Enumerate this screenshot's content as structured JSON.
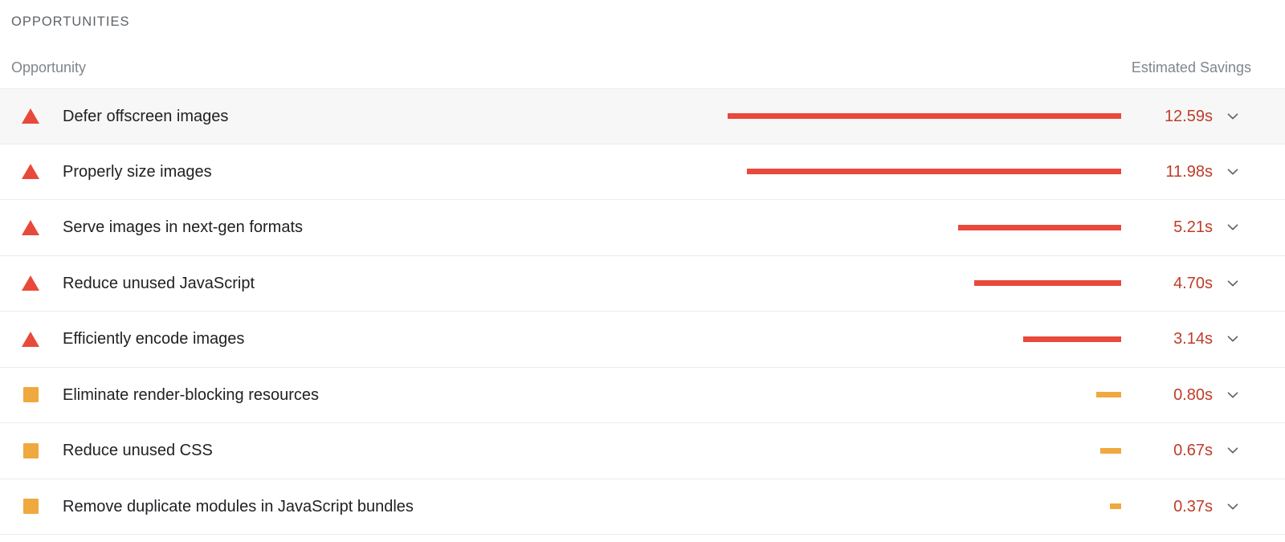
{
  "section": {
    "title": "OPPORTUNITIES"
  },
  "columns": {
    "opportunity": "Opportunity",
    "estimated_savings": "Estimated Savings"
  },
  "colors": {
    "severity_high": "#e8493a",
    "severity_medium": "#efa93f",
    "savings_text": "#bf3c28",
    "row_hover_bg": "#f7f7f7",
    "row_border": "#ebebeb",
    "header_text": "#80868b",
    "title_text": "#5f6368"
  },
  "icons": {
    "expand": "chevron-down-icon",
    "severity_high": "warning-triangle-icon",
    "severity_medium": "warning-square-icon"
  },
  "chart_data": {
    "type": "bar",
    "title": "OPPORTUNITIES",
    "xlabel": "Estimated Savings (seconds)",
    "ylabel": "Opportunity",
    "orientation": "horizontal",
    "categories": [
      "Defer offscreen images",
      "Properly size images",
      "Serve images in next-gen formats",
      "Reduce unused JavaScript",
      "Efficiently encode images",
      "Eliminate render-blocking resources",
      "Reduce unused CSS",
      "Remove duplicate modules in JavaScript bundles"
    ],
    "values": [
      12.59,
      11.98,
      5.21,
      4.7,
      3.14,
      0.8,
      0.67,
      0.37
    ],
    "units": "s",
    "xlim": [
      0,
      12.59
    ],
    "grid": false,
    "legend": false
  },
  "rows": [
    {
      "severity": "high",
      "title": "Defer offscreen images",
      "savings": "12.59s",
      "value": 12.59,
      "hovered": true
    },
    {
      "severity": "high",
      "title": "Properly size images",
      "savings": "11.98s",
      "value": 11.98,
      "hovered": false
    },
    {
      "severity": "high",
      "title": "Serve images in next-gen formats",
      "savings": "5.21s",
      "value": 5.21,
      "hovered": false
    },
    {
      "severity": "high",
      "title": "Reduce unused JavaScript",
      "savings": "4.70s",
      "value": 4.7,
      "hovered": false
    },
    {
      "severity": "high",
      "title": "Efficiently encode images",
      "savings": "3.14s",
      "value": 3.14,
      "hovered": false
    },
    {
      "severity": "medium",
      "title": "Eliminate render-blocking resources",
      "savings": "0.80s",
      "value": 0.8,
      "hovered": false
    },
    {
      "severity": "medium",
      "title": "Reduce unused CSS",
      "savings": "0.67s",
      "value": 0.67,
      "hovered": false
    },
    {
      "severity": "medium",
      "title": "Remove duplicate modules in JavaScript bundles",
      "savings": "0.37s",
      "value": 0.37,
      "hovered": false
    }
  ]
}
